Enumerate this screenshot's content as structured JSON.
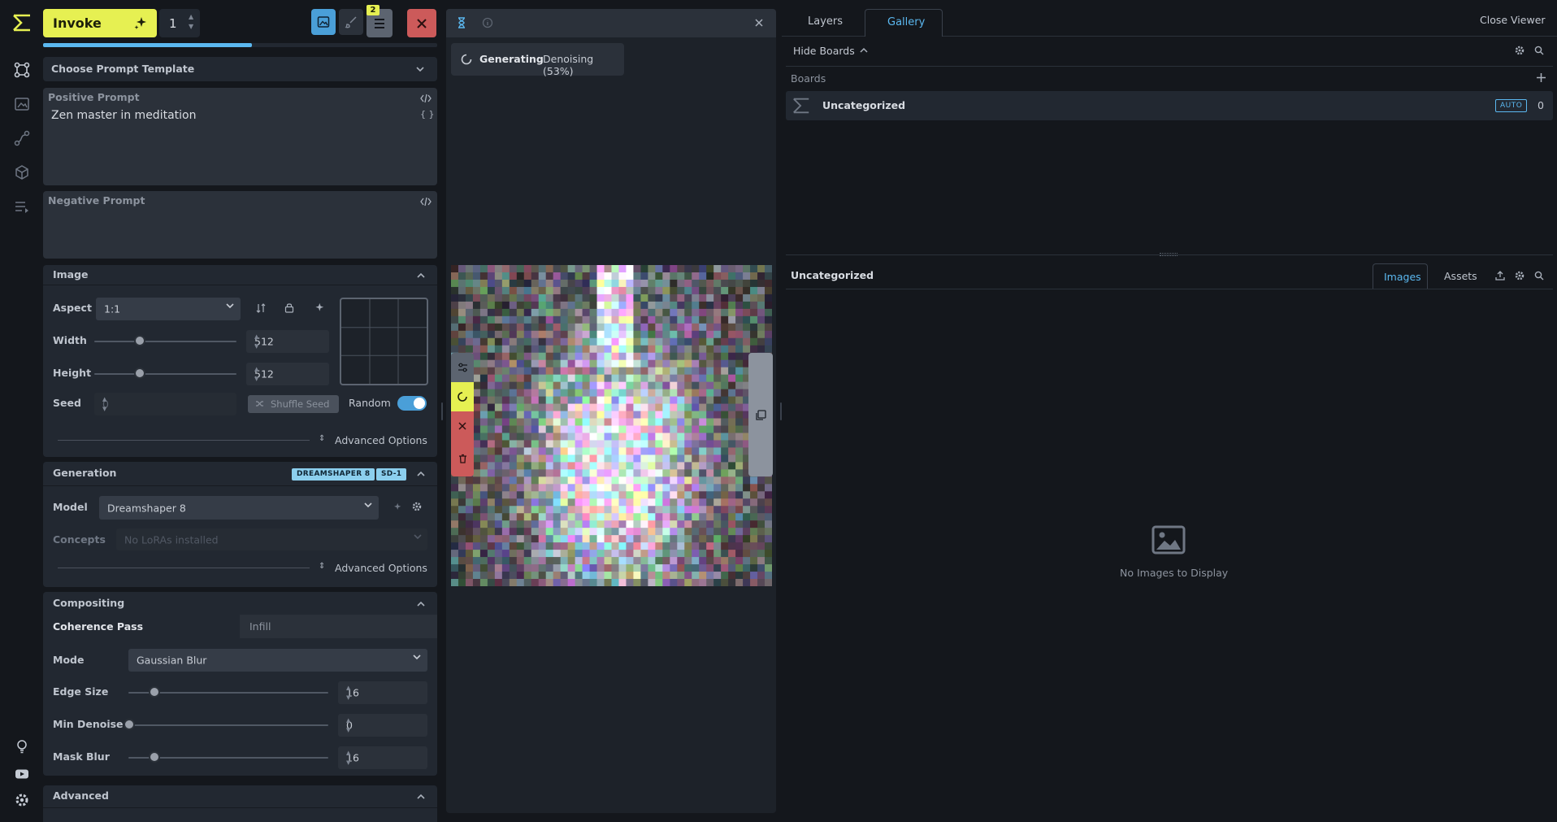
{
  "toolbar": {
    "invoke_label": "Invoke",
    "iterations_value": "1",
    "queue_badge": "2",
    "progress_percent": 53
  },
  "prompt_template": {
    "label": "Choose Prompt Template"
  },
  "positive_prompt": {
    "label": "Positive Prompt",
    "value": "Zen master in meditation"
  },
  "negative_prompt": {
    "label": "Negative Prompt",
    "value": ""
  },
  "image": {
    "title": "Image",
    "aspect_label": "Aspect",
    "aspect_value": "1:1",
    "width_label": "Width",
    "width_value": "512",
    "height_label": "Height",
    "height_value": "512",
    "seed_label": "Seed",
    "seed_value": "0",
    "shuffle_label": "Shuffle Seed",
    "random_label": "Random",
    "random_on": true,
    "advanced_label": "Advanced Options"
  },
  "generation": {
    "title": "Generation",
    "badge_model": "DREAMSHAPER 8",
    "badge_base": "SD-1",
    "model_label": "Model",
    "model_value": "Dreamshaper 8",
    "concepts_label": "Concepts",
    "concepts_placeholder": "No LoRAs installed",
    "advanced_label": "Advanced Options"
  },
  "compositing": {
    "title": "Compositing",
    "tab_coherence": "Coherence Pass",
    "tab_infill": "Infill",
    "mode_label": "Mode",
    "mode_value": "Gaussian Blur",
    "edge_label": "Edge Size",
    "edge_value": "16",
    "denoise_label": "Min Denoise",
    "denoise_value": "0",
    "mask_label": "Mask Blur",
    "mask_value": "16"
  },
  "advanced": {
    "title": "Advanced"
  },
  "viewer": {
    "status_main": "Generating",
    "status_detail": "Denoising (53%)"
  },
  "gallery": {
    "tab_layers": "Layers",
    "tab_gallery": "Gallery",
    "close_viewer": "Close Viewer",
    "hide_boards": "Hide Boards",
    "boards_label": "Boards",
    "board_name": "Uncategorized",
    "board_auto": "AUTO",
    "board_count": "0",
    "section_title": "Uncategorized",
    "tab_images": "Images",
    "tab_assets": "Assets",
    "empty_text": "No Images to Display"
  },
  "colors": {
    "accent_yellow": "#e6f052",
    "accent_blue": "#5bb8f0",
    "danger": "#cc5a5a",
    "panel_bg": "#222831"
  }
}
